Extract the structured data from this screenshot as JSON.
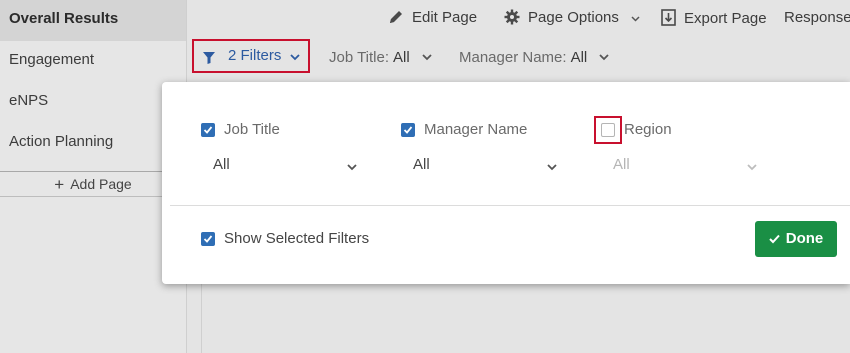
{
  "sidebar": {
    "items": [
      {
        "label": "Overall Results",
        "active": true
      },
      {
        "label": "Engagement"
      },
      {
        "label": "eNPS"
      },
      {
        "label": "Action Planning"
      }
    ],
    "add_page_label": "Add Page"
  },
  "toolbar": {
    "edit_page": "Edit Page",
    "page_options": "Page Options",
    "export_page": "Export Page",
    "responses": "Responses"
  },
  "filterbar": {
    "filters_button": "2 Filters",
    "filters": [
      {
        "label": "Job Title:",
        "value": "All"
      },
      {
        "label": "Manager Name:",
        "value": "All"
      }
    ]
  },
  "popup": {
    "fields": [
      {
        "label": "Job Title",
        "checked": true,
        "value": "All"
      },
      {
        "label": "Manager Name",
        "checked": true,
        "value": "All"
      },
      {
        "label": "Region",
        "checked": false,
        "value": "All",
        "disabled": true
      }
    ],
    "show_selected_label": "Show Selected Filters",
    "show_selected_checked": true,
    "done_label": "Done"
  },
  "colors": {
    "accent_blue": "#2c5aa0",
    "checkbox_blue": "#2f6eb5",
    "highlight_red": "#c8102e",
    "done_green": "#1a8f45"
  }
}
